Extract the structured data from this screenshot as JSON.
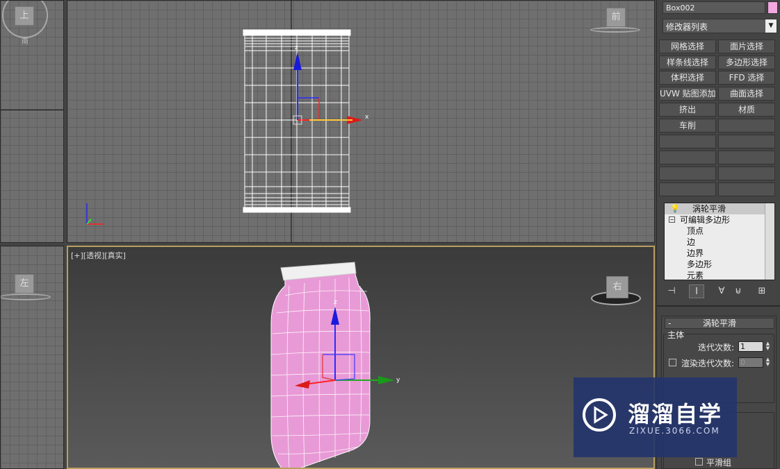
{
  "viewports": {
    "top_cube": "上",
    "top_cube_sub": "南",
    "front_cube": "前",
    "left_cube": "左",
    "persp_cube": "右",
    "persp_label": "[+][透视][真实]",
    "front_axis_z": "z",
    "front_axis_x": "x",
    "persp_axis_z": "z",
    "persp_axis_y": "y"
  },
  "command_panel": {
    "object_name": "Box002",
    "object_color": "#f2a8e0",
    "modifier_list": "修改器列表",
    "buttons": [
      "网格选择",
      "面片选择",
      "样条线选择",
      "多边形选择",
      "体积选择",
      "FFD 选择",
      "UVW 贴图添加",
      "曲面选择",
      "挤出",
      "材质",
      "车削",
      "",
      "",
      "",
      "",
      "",
      "",
      "",
      "",
      ""
    ],
    "stack": {
      "modifier": "涡轮平滑",
      "base": "可编辑多边形",
      "sub": [
        "顶点",
        "边",
        "边界",
        "多边形",
        "元素"
      ]
    },
    "rollout": {
      "title": "涡轮平滑",
      "collapse": "-",
      "group_main": "主体",
      "iterations_label": "迭代次数:",
      "iterations_value": "1",
      "render_iters_label": "渲染迭代次数:",
      "render_iters_value": "0",
      "smooth_group_label": "平滑组"
    }
  },
  "watermark": {
    "title": "溜溜自学",
    "url": "ZIXUE.3066.COM"
  }
}
